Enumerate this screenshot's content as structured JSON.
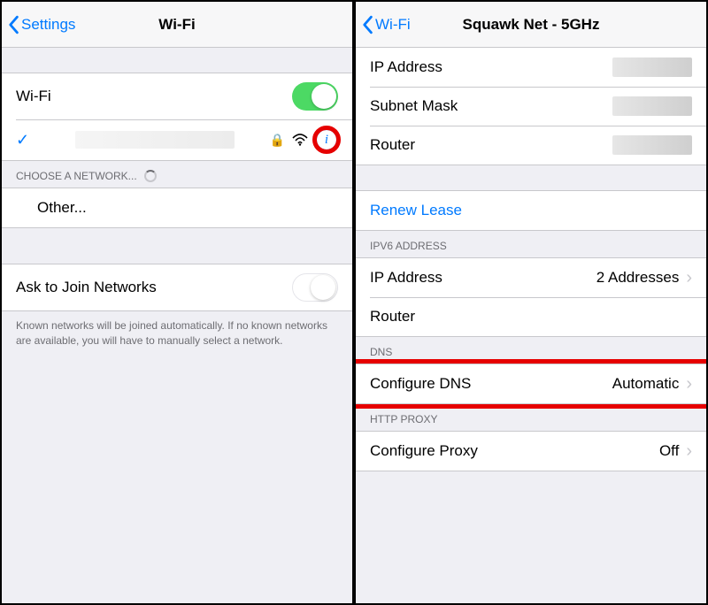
{
  "left": {
    "back": "Settings",
    "title": "Wi-Fi",
    "wifi_label": "Wi-Fi",
    "choose_header": "CHOOSE A NETWORK...",
    "other_label": "Other...",
    "ask_label": "Ask to Join Networks",
    "ask_note": "Known networks will be joined automatically. If no known networks are available, you will have to manually select a network."
  },
  "right": {
    "back": "Wi-Fi",
    "title": "Squawk Net - 5GHz",
    "ip_label": "IP Address",
    "subnet_label": "Subnet Mask",
    "router_label": "Router",
    "renew_label": "Renew Lease",
    "ipv6_header": "IPV6 ADDRESS",
    "ipv6_ip_label": "IP Address",
    "ipv6_ip_value": "2 Addresses",
    "ipv6_router_label": "Router",
    "dns_header": "DNS",
    "dns_label": "Configure DNS",
    "dns_value": "Automatic",
    "proxy_header": "HTTP PROXY",
    "proxy_label": "Configure Proxy",
    "proxy_value": "Off"
  }
}
